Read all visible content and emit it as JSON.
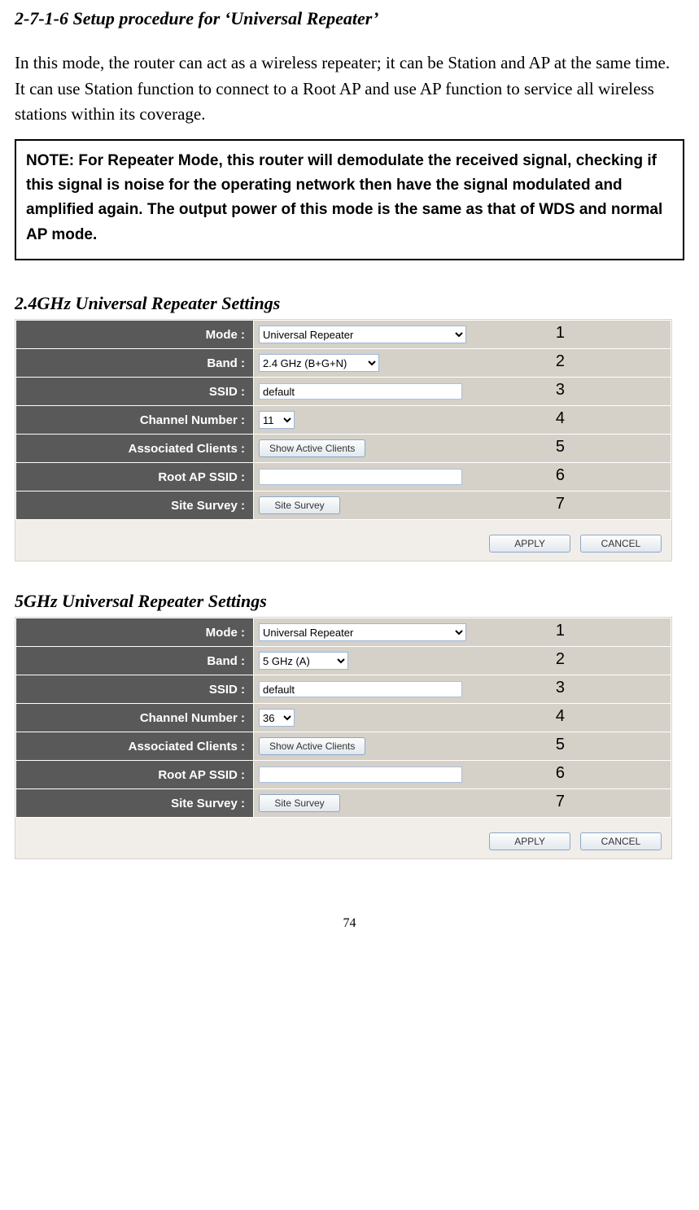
{
  "title": "2-7-1-6 Setup procedure for ‘Universal Repeater’",
  "intro": "In this mode, the router can act as a wireless repeater; it can be Station and AP at the same time. It can use Station function to connect to a Root AP and use AP function to service all wireless stations within its coverage.",
  "note": "NOTE: For Repeater Mode, this router will demodulate the received signal, checking if this signal is noise for the operating network then have the signal modulated and amplified again. The output power of this mode is the same as that of WDS and normal AP mode.",
  "section24_title": "2.4GHz Universal Repeater Settings",
  "section5_title": "5GHz Universal Repeater Settings",
  "labels": {
    "mode": "Mode :",
    "band": "Band :",
    "ssid": "SSID :",
    "channel": "Channel Number :",
    "clients": "Associated Clients :",
    "rootap": "Root AP SSID :",
    "sitesurvey": "Site Survey :"
  },
  "values24": {
    "mode": "Universal Repeater",
    "band": "2.4 GHz (B+G+N)",
    "ssid": "default",
    "channel": "11",
    "clients_btn": "Show Active Clients",
    "rootap": "",
    "sitesurvey_btn": "Site Survey"
  },
  "values5": {
    "mode": "Universal Repeater",
    "band": "5 GHz (A)",
    "ssid": "default",
    "channel": "36",
    "clients_btn": "Show Active Clients",
    "rootap": "",
    "sitesurvey_btn": "Site Survey"
  },
  "buttons": {
    "apply": "APPLY",
    "cancel": "CANCEL"
  },
  "rownums": [
    "1",
    "2",
    "3",
    "4",
    "5",
    "6",
    "7"
  ],
  "pagenum": "74"
}
